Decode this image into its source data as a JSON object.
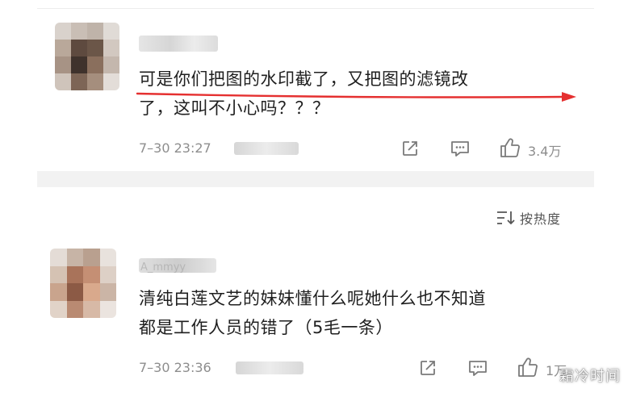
{
  "comments": [
    {
      "text_line1": "可是你们把图的水印截了，又把图的滤镜改",
      "text_line2": "了，这叫不小心吗？？？",
      "time": "7–30 23:27",
      "likes": "3.4万"
    },
    {
      "username": "A_mmyy",
      "text_line1": "清纯白莲文艺的妹妹懂什么呢她什么也不知道",
      "text_line2": "都是工作人员的错了（5毛一条）",
      "time": "7–30 23:36",
      "likes": "1万"
    }
  ],
  "sort": {
    "label": "按热度"
  },
  "watermark": "霜冷时间",
  "colors": {
    "annotation_arrow": "#e53030",
    "meta_gray": "#8d8d8d"
  },
  "icons": [
    "share-icon",
    "reply-icon",
    "like-icon",
    "sort-icon"
  ]
}
